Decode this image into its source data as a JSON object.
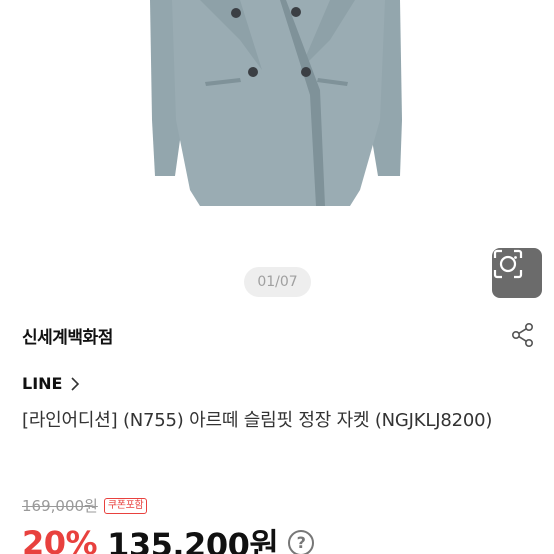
{
  "product_image": {
    "page_indicator": "01/07",
    "colors": {
      "jacket": "#9aacb3",
      "jacket_shadow": "#7f9299",
      "button": "#3b3f44",
      "background": "#ffffff"
    }
  },
  "store": {
    "name": "신세계백화점",
    "share_icon": "share-icon"
  },
  "brand": {
    "name": "LINE",
    "chevron": "›"
  },
  "product": {
    "title": "[라인어디션] (N755) 아르떼 슬림핏 정장 자켓 (NGJKLJ8200)"
  },
  "price": {
    "original": "169,000원",
    "coupon_badge": "쿠폰포함",
    "discount": "20%",
    "sale": "135,200원",
    "help": "?"
  },
  "colors": {
    "accent_red": "#e8413e",
    "text_dark": "#111111",
    "muted": "#9a9a9a"
  }
}
